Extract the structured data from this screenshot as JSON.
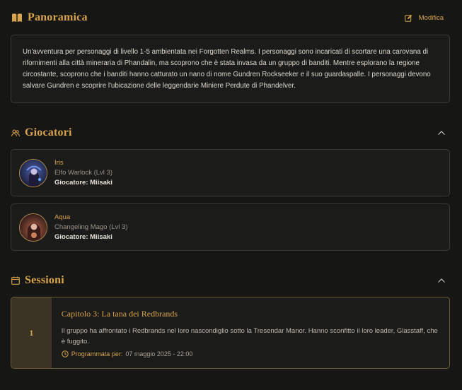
{
  "overview": {
    "title": "Panoramica",
    "edit_label": "Modifica",
    "description": "Un'avventura per personaggi di livello 1-5 ambientata nei Forgotten Realms. I personaggi sono incaricati di scortare una carovana di rifornimenti alla città mineraria di Phandalin, ma scoprono che è stata invasa da un gruppo di banditi. Mentre esplorano la regione circostante, scoprono che i banditi hanno catturato un nano di nome Gundren Rockseeker e il suo guardaspalle. I personaggi devono salvare Gundren e scoprire l'ubicazione delle leggendarie Miniere Perdute di Phandelver."
  },
  "players": {
    "title": "Giocatori",
    "items": [
      {
        "name": "Iris",
        "class": "Elfo Warlock (Lvl 3)",
        "player": "Giocatore: Miisaki"
      },
      {
        "name": "Aqua",
        "class": "Changeling Mago (Lvl 3)",
        "player": "Giocatore: Miisaki"
      }
    ]
  },
  "sessions": {
    "title": "Sessioni",
    "items": [
      {
        "number": "1",
        "title": "Capitolo 3: La tana dei Redbrands",
        "description": "Il gruppo ha affrontato i Redbrands nel loro nascondiglio sotto la Tresendar Manor. Hanno sconfitto il loro leader, Glasstaff, che è fuggito.",
        "scheduled_label": "Programmata per:",
        "scheduled_value": "07 maggio 2025 - 22:00"
      }
    ]
  },
  "colors": {
    "accent": "#d9a54c",
    "background": "#161615",
    "card_border": "#3d3a33"
  }
}
